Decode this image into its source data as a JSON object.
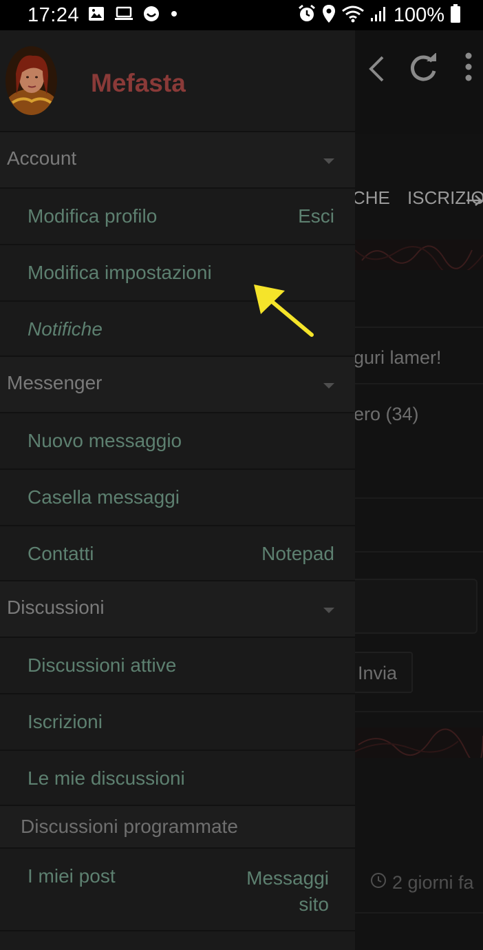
{
  "status_bar": {
    "time": "17:24",
    "battery": "100%",
    "left_icons": [
      "image-icon",
      "laptop-icon",
      "smiley-icon",
      "dot-icon"
    ],
    "right_icons": [
      "alarm-icon",
      "location-icon",
      "wifi-icon",
      "signal-icon",
      "battery-icon"
    ]
  },
  "drawer": {
    "username": "Mefasta",
    "sections": [
      {
        "label": "Account",
        "items": [
          {
            "label": "Modifica profilo",
            "right": "Esci"
          },
          {
            "label": "Modifica impostazioni"
          },
          {
            "label": "Notifiche"
          }
        ]
      },
      {
        "label": "Messenger",
        "items": [
          {
            "label": "Nuovo messaggio"
          },
          {
            "label": "Casella messaggi"
          },
          {
            "label": "Contatti",
            "right": "Notepad"
          }
        ]
      },
      {
        "label": "Discussioni",
        "items": [
          {
            "label": "Discussioni attive"
          },
          {
            "label": "Iscrizioni"
          },
          {
            "label": "Le mie discussioni"
          },
          {
            "label": "Discussioni programmate"
          },
          {
            "label": "I miei post",
            "right_line1": "Messaggi",
            "right_line2": "sito"
          }
        ]
      }
    ]
  },
  "background_page": {
    "tab_1": "CHE",
    "tab_2": "ISCRIZIO",
    "text_1": "guri lamer!",
    "text_2": "ero (34)",
    "send_button": "Invia",
    "time_text": "2 giorni fa"
  },
  "colors": {
    "drawer_bg": "#1a1a1a",
    "section_bg": "#1d1d1d",
    "username": "#8a3a38",
    "item_text": "#5d8070",
    "section_text": "#7a7a7a",
    "annotation_arrow": "#f5e42a"
  }
}
